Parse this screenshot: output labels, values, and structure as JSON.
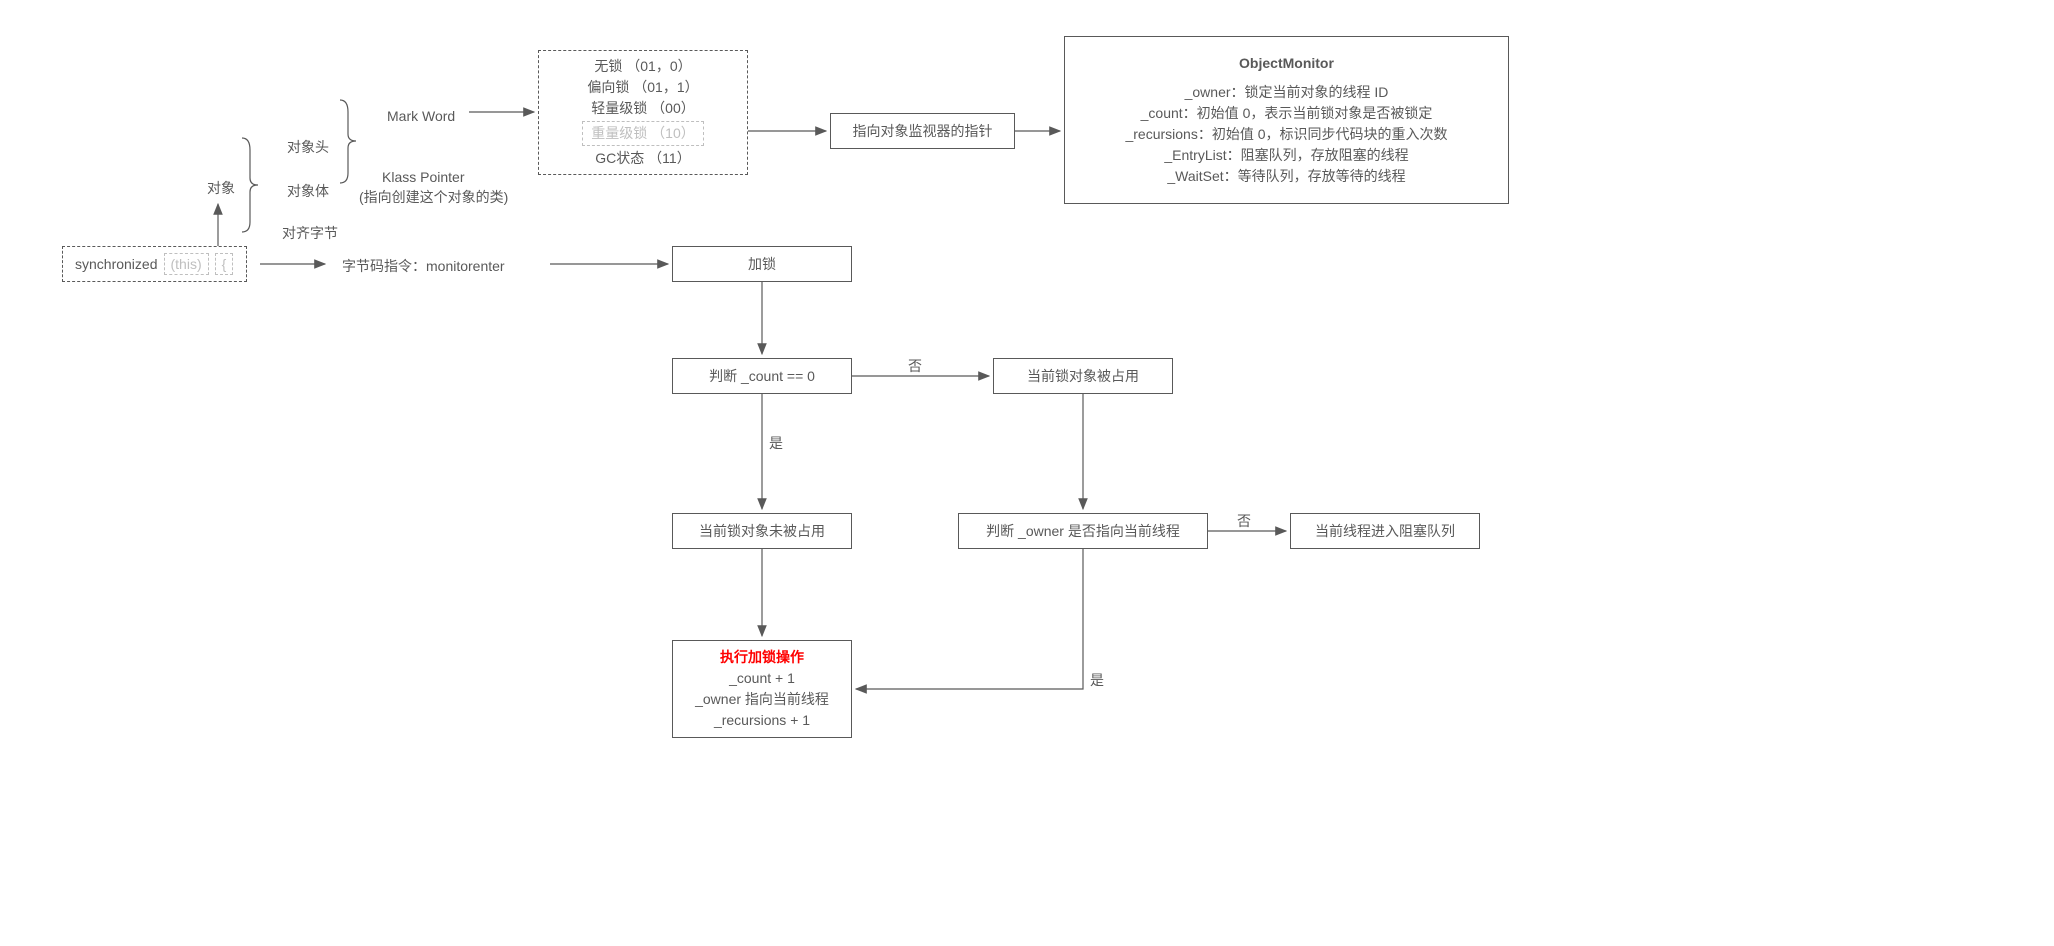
{
  "synchronized_box": {
    "kw": "synchronized",
    "this": "(this)",
    "brace": "{"
  },
  "object_tree": {
    "root": "对象",
    "head": "对象头",
    "body": "对象体",
    "align": "对齐字节",
    "mark_word": "Mark Word",
    "klass_pointer": "Klass Pointer",
    "klass_desc": "(指向创建这个对象的类)"
  },
  "mark_word_box": {
    "l1": "无锁 （01，0）",
    "l2": "偏向锁 （01，1）",
    "l3": "轻量级锁 （00）",
    "l4": "重量级锁 （10）",
    "l5": "GC状态 （11）"
  },
  "bytecode": "字节码指令：monitorenter",
  "monitor_pointer": "指向对象监视器的指针",
  "object_monitor": {
    "title": "ObjectMonitor",
    "l1": "_owner：锁定当前对象的线程 ID",
    "l2": "_count：初始值 0，表示当前锁对象是否被锁定",
    "l3": "_recursions：初始值 0，标识同步代码块的重入次数",
    "l4": "_EntryList：阻塞队列，存放阻塞的线程",
    "l5": "_WaitSet：等待队列，存放等待的线程"
  },
  "flow": {
    "lock": "加锁",
    "check_count": "判断 _count == 0",
    "occupied": "当前锁对象被占用",
    "not_occupied": "当前锁对象未被占用",
    "check_owner": "判断 _owner 是否指向当前线程",
    "enter_block": "当前线程进入阻塞队列",
    "do_lock_title": "执行加锁操作",
    "do_lock_l1": "_count + 1",
    "do_lock_l2": "_owner 指向当前线程",
    "do_lock_l3": "_recursions + 1"
  },
  "labels": {
    "yes": "是",
    "no": "否"
  }
}
